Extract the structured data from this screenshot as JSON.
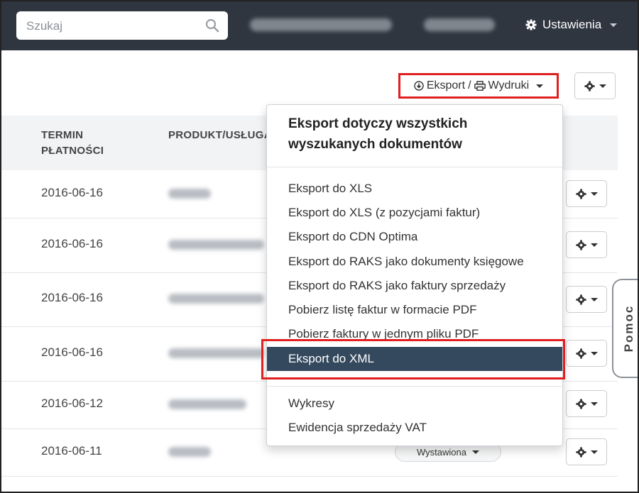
{
  "navbar": {
    "search_placeholder": "Szukaj",
    "settings_label": "Ustawienia"
  },
  "toolbar": {
    "export_label": "Eksport",
    "separator": "/",
    "print_label": "Wydruki"
  },
  "table": {
    "headers": {
      "termin_line1": "TERMIN",
      "termin_line2": "PŁATNOŚCI",
      "produkt": "PRODUKT/USŁUGA"
    },
    "rows": [
      {
        "date": "2016-06-16",
        "status": ""
      },
      {
        "date": "2016-06-16",
        "status": ""
      },
      {
        "date": "2016-06-16",
        "status": ""
      },
      {
        "date": "2016-06-16",
        "status": ""
      },
      {
        "date": "2016-06-12",
        "status": ""
      },
      {
        "date": "2016-06-11",
        "status": "Wystawiona"
      }
    ]
  },
  "dropdown": {
    "header_line1": "Eksport dotyczy wszystkich",
    "header_line2": "wyszukanych dokumentów",
    "items": [
      "Eksport do XLS",
      "Eksport do XLS (z pozycjami faktur)",
      "Eksport do CDN Optima",
      "Eksport do RAKS jako dokumenty księgowe",
      "Eksport do RAKS jako faktury sprzedaży",
      "Pobierz listę faktur w formacie PDF",
      "Pobierz faktury w jednym pliku PDF",
      "Eksport do XML"
    ],
    "active_item": "Eksport do XML",
    "extra_items": [
      "Wykresy",
      "Ewidencja sprzedaży VAT"
    ]
  },
  "help_tab": "Pomoc",
  "colors": {
    "navbar_bg": "#2f3640",
    "active_item_bg": "#34495e",
    "highlight_border": "#e02020"
  }
}
